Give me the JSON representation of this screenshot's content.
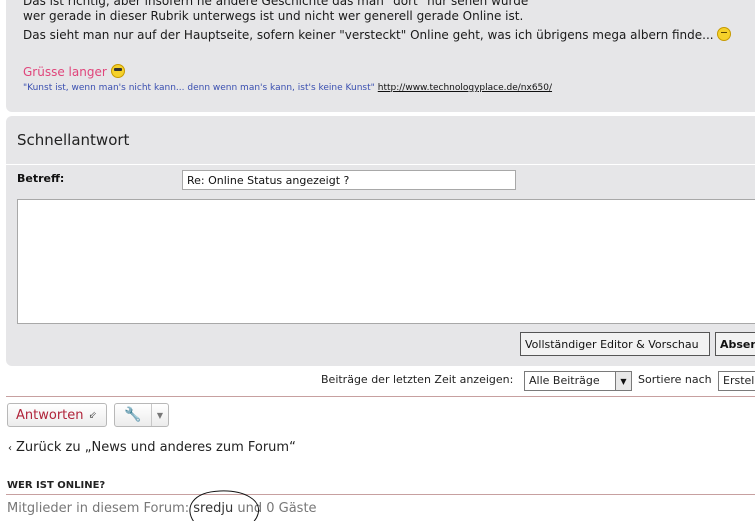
{
  "post": {
    "line0": "Das ist richtig, aber insofern ne andere Geschichte das man \"dort\" nur sehen würde",
    "line1": "wer gerade in dieser Rubrik unterwegs ist und nicht wer generell gerade Online ist.",
    "line2": "Das sieht man nur auf der Hauptseite, sofern keiner \"versteckt\" Online geht, was ich übrigens mega albern finde...",
    "signature": {
      "greeting": "Grüsse langer",
      "quote": "\"Kunst ist, wenn man's nicht kann... denn wenn man's kann, ist's keine Kunst\"",
      "link": "http://www.technologyplace.de/nx650/"
    }
  },
  "quick_reply": {
    "title": "Schnellantwort",
    "subject_label": "Betreff:",
    "subject_value": "Re: Online Status angezeigt ?",
    "editor_button": "Vollständiger Editor & Vorschau",
    "send_button": "Absenden"
  },
  "filters": {
    "recent_label": "Beiträge der letzten Zeit anzeigen:",
    "recent_value": "Alle Beiträge",
    "sort_label": "Sortiere nach",
    "sort_value": "Erstellungsdatum"
  },
  "actions": {
    "reply_label": "Antworten",
    "back_label": "Zurück zu „News und anderes zum Forum“"
  },
  "online": {
    "heading": "WER IST ONLINE?",
    "prefix": "Mitglieder in diesem Forum:",
    "user": "sredju",
    "suffix": "und 0 Gäste"
  },
  "icons": {
    "smiley": "smiley-icon",
    "cool_smiley": "cool-smiley-icon",
    "reply": "reply-arrow-icon",
    "wrench": "wrench-icon",
    "caret": "caret-down-icon",
    "back": "chevron-left-icon"
  },
  "colors": {
    "panel_bg": "#e6e6e8",
    "signature_pink": "#e0457b",
    "signature_blue": "#3a4fb0",
    "reply_red": "#b0243a"
  }
}
